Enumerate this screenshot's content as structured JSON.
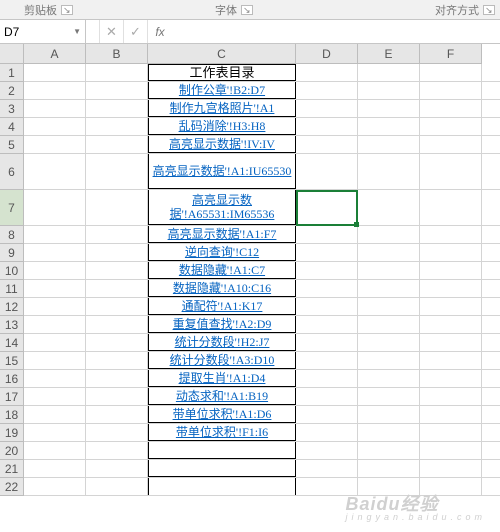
{
  "ribbon": {
    "clipboard": "剪贴板",
    "font": "字体",
    "alignment": "对齐方式"
  },
  "formula_bar": {
    "name_box": "D7",
    "cancel": "✕",
    "confirm": "✓",
    "fx": "fx",
    "value": ""
  },
  "columns": [
    "A",
    "B",
    "C",
    "D",
    "E",
    "F"
  ],
  "rows": [
    "1",
    "2",
    "3",
    "4",
    "5",
    "6",
    "7",
    "8",
    "9",
    "10",
    "11",
    "12",
    "13",
    "14",
    "15",
    "16",
    "17",
    "18",
    "19",
    "20",
    "21",
    "22"
  ],
  "active_row": "7",
  "title": "工作表目录",
  "links": [
    "制作公章'!B2:D7",
    "制作九宫格照片'!A1",
    "乱码消除'!H3:H8",
    "高亮显示数据'!IV:IV",
    "高亮显示数据'!A1:IU65530",
    "高亮显示数据'!A65531:IM65536",
    "高亮显示数据'!A1:F7",
    "逆向查询'!C12",
    "数据隐藏'!A1:C7",
    "数据隐藏'!A10:C16",
    "通配符'!A1:K17",
    "重复值查找'!A2:D9",
    "统计分数段'!H2:J7",
    "统计分数段'!A3:D10",
    "提取生肖'!A1:D4",
    "动态求和'!A1:B19",
    "带单位求积'!A1:D6",
    "带单位求积'!F1:I6"
  ],
  "watermark": {
    "main": "Baidu经验",
    "sub": "jingyan.baidu.com"
  }
}
